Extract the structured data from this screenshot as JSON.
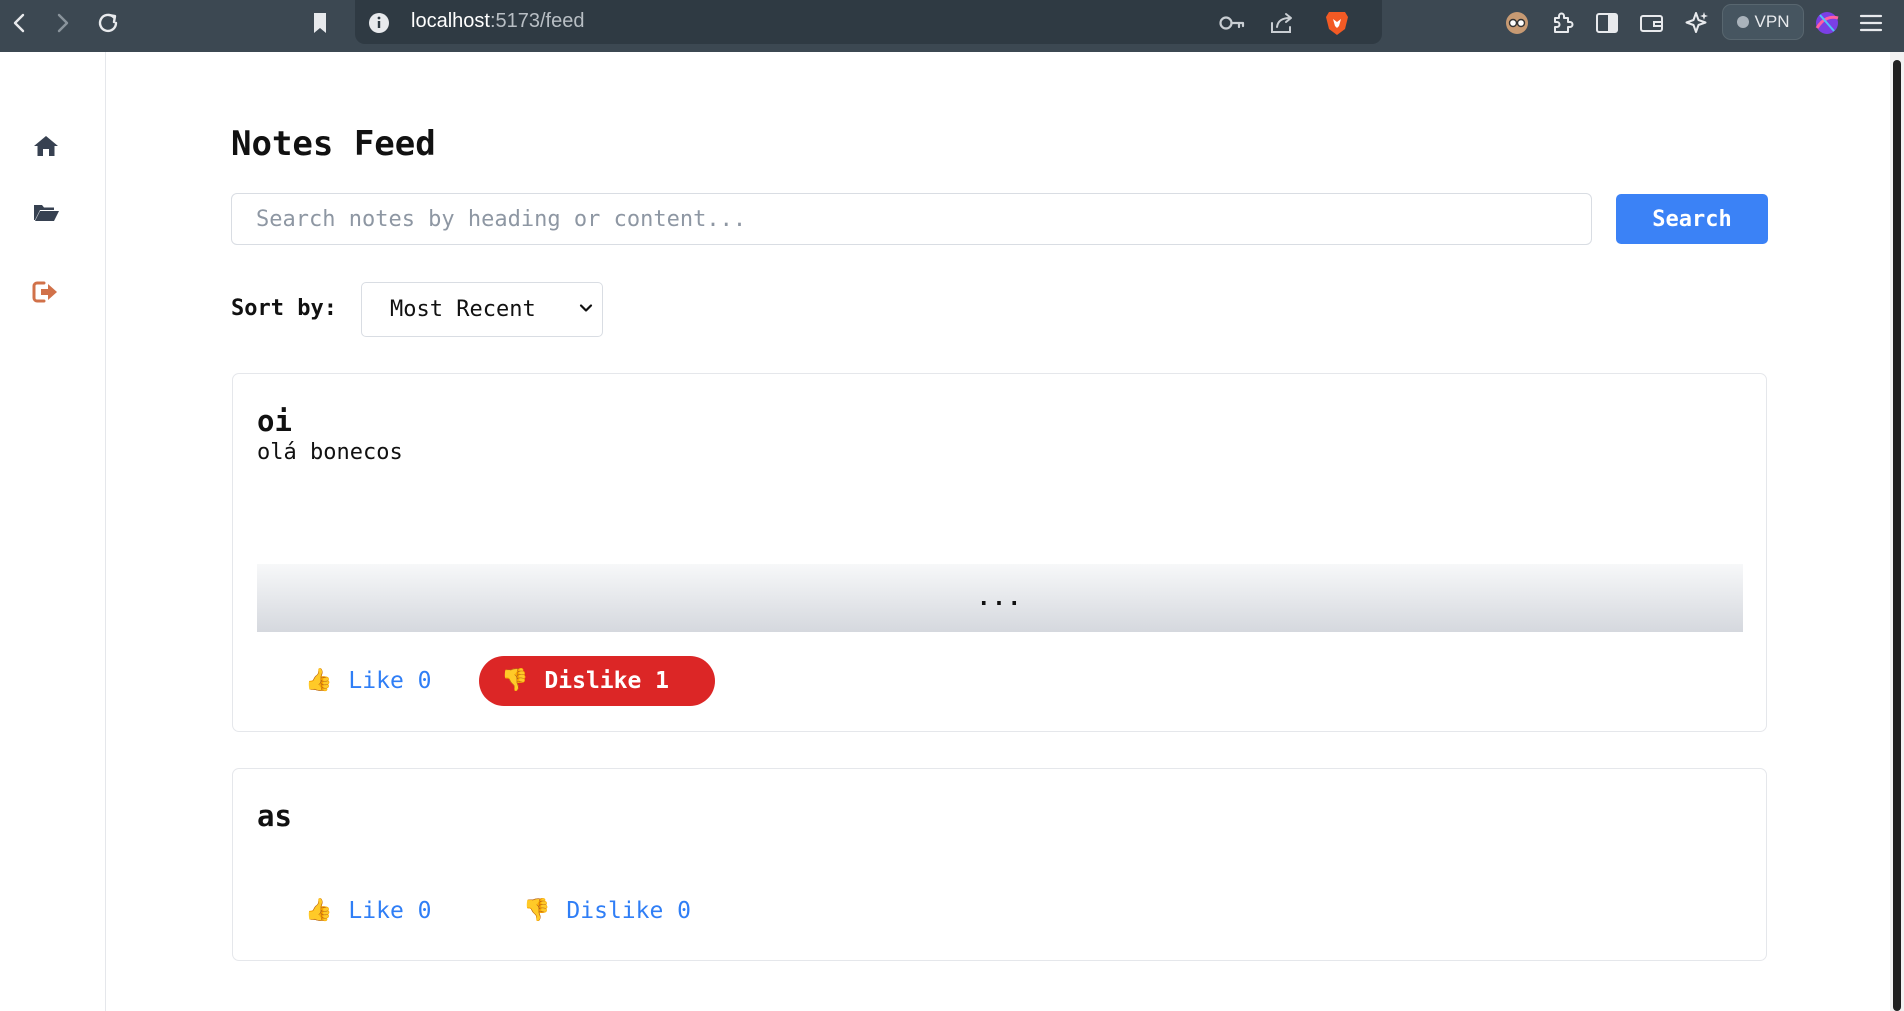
{
  "browser": {
    "url_host": "localhost",
    "url_path": ":5173/feed",
    "vpn_label": "VPN"
  },
  "sidebar": {
    "items": [
      {
        "name": "home"
      },
      {
        "name": "folder"
      },
      {
        "name": "logout"
      }
    ]
  },
  "page": {
    "title": "Notes Feed",
    "search_placeholder": "Search notes by heading or content...",
    "search_button": "Search",
    "sort_label": "Sort by:",
    "sort_selected": "Most Recent"
  },
  "notes": [
    {
      "heading": "oi",
      "content": "olá bonecos",
      "more": "...",
      "like_label": "Like 0",
      "dislike_label": "Dislike 1",
      "like_emoji": "👍",
      "dislike_emoji": "👎"
    },
    {
      "heading": "as",
      "like_label": "Like 0",
      "dislike_label": "Dislike 0",
      "like_emoji": "👍",
      "dislike_emoji": "👎"
    }
  ],
  "colors": {
    "accent": "#3b82f6",
    "dislike_active": "#dc2626",
    "chrome": "#3c4852"
  }
}
